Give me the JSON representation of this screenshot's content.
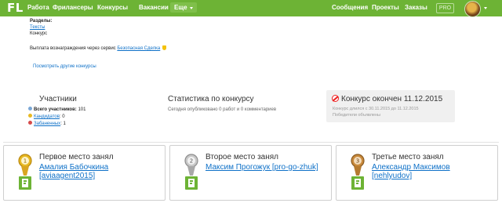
{
  "topbar": {
    "logo": "FL",
    "nav": [
      "Работа",
      "Фрилансеры",
      "Конкурсы",
      "Вакансии"
    ],
    "more": "Еще",
    "right_nav": [
      "Сообщения",
      "Проекты",
      "Заказы"
    ],
    "pro": "PRO",
    "colors": {
      "bar": "#6db335",
      "text": "#ffffff"
    }
  },
  "info": {
    "sections_label": "Разделы:",
    "section_link": "Тексты",
    "section_sub": "Конкурс",
    "payment_text": "Выплата вознаграждения через сервис",
    "payment_link": "Безопасная Сделка",
    "other_contests": "Посмотреть другие конкурсы"
  },
  "participants": {
    "title": "Участники",
    "total_label": "Всего участников:",
    "total_value": "101",
    "candidates_label": "Кандидатов",
    "candidates_value": ": 0",
    "banned_label": "Забаненных",
    "banned_value": ": 1"
  },
  "stats": {
    "title": "Статистика по конкурсу",
    "today": "Сегодня опубликовано 0 работ и 0 комментариев"
  },
  "ended": {
    "title": "Конкурс окончен 11.12.2015",
    "duration": "Конкурс длился с 30.11.2015 до 11.12.2015",
    "winners_announced": "Победители объявлены"
  },
  "winners": [
    {
      "place": "Первое место занял",
      "name": "Амалия Бабочкина [aviaagent2015]",
      "medal_number": "1",
      "medal_color": "#e8b923"
    },
    {
      "place": "Второе место занял",
      "name": "Максим Прогожук [pro-go-zhuk]",
      "medal_number": "2",
      "medal_color": "#b8b8b8"
    },
    {
      "place": "Третье место занял",
      "name": "Александр Максимов [nehlyudov]",
      "medal_number": "3",
      "medal_color": "#c98a3c"
    }
  ]
}
